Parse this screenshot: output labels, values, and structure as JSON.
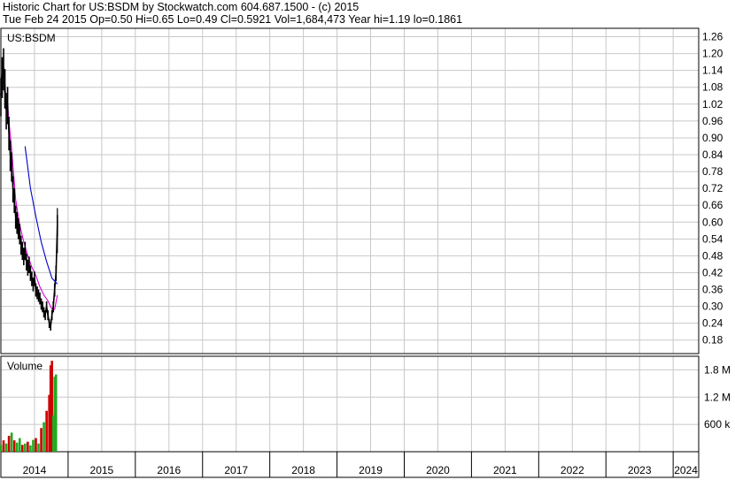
{
  "header": {
    "line1": "Historic Chart for US:BSDM by Stockwatch.com 604.687.1500 - (c) 2015",
    "line2": "Tue Feb 24 2015  Op=0.50  Hi=0.65  Lo=0.49  Cl=0.5921  Vol=1,684,473  Year hi=1.19  lo=0.1861"
  },
  "chart_data": [
    {
      "type": "line",
      "title": "US:BSDM",
      "y_ticks": [
        "1.26",
        "1.20",
        "1.14",
        "1.08",
        "1.02",
        "0.96",
        "0.90",
        "0.84",
        "0.78",
        "0.72",
        "0.66",
        "0.60",
        "0.54",
        "0.48",
        "0.42",
        "0.36",
        "0.30",
        "0.24",
        "0.18"
      ],
      "x_ticks": [
        "2014",
        "2015",
        "2016",
        "2017",
        "2018",
        "2019",
        "2020",
        "2021",
        "2022",
        "2023",
        "2024"
      ],
      "ylim": [
        0.132,
        1.29
      ],
      "xlim": [
        2014.0,
        2024.38
      ],
      "colors": {
        "price": "#000000",
        "ma_short": "#d400d4",
        "ma_long": "#0000cc",
        "grid": "#c8c8c8"
      },
      "series": [
        {
          "role": "price",
          "x": [
            2014.0,
            2014.02,
            2014.04,
            2014.06,
            2014.08,
            2014.1,
            2014.12,
            2014.14,
            2014.16,
            2014.18,
            2014.2,
            2014.22,
            2014.24,
            2014.26,
            2014.28,
            2014.3,
            2014.32,
            2014.34,
            2014.36,
            2014.38,
            2014.4,
            2014.42,
            2014.44,
            2014.46,
            2014.48,
            2014.5,
            2014.52,
            2014.54,
            2014.56,
            2014.58,
            2014.6,
            2014.62,
            2014.64,
            2014.66,
            2014.68,
            2014.7,
            2014.72,
            2014.74,
            2014.76,
            2014.78,
            2014.8,
            2014.82,
            2014.84
          ],
          "y": [
            1.05,
            1.12,
            1.15,
            1.08,
            1.0,
            1.02,
            0.92,
            0.84,
            0.8,
            0.72,
            0.68,
            0.62,
            0.6,
            0.58,
            0.56,
            0.52,
            0.5,
            0.48,
            0.5,
            0.46,
            0.44,
            0.45,
            0.42,
            0.4,
            0.38,
            0.4,
            0.36,
            0.35,
            0.34,
            0.33,
            0.31,
            0.3,
            0.28,
            0.27,
            0.3,
            0.27,
            0.24,
            0.23,
            0.27,
            0.3,
            0.36,
            0.42,
            0.59
          ]
        },
        {
          "role": "ma_short",
          "x": [
            2014.04,
            2014.1,
            2014.16,
            2014.22,
            2014.28,
            2014.34,
            2014.4,
            2014.46,
            2014.52,
            2014.58,
            2014.64,
            2014.7,
            2014.76,
            2014.8,
            2014.84
          ],
          "y": [
            1.08,
            1.01,
            0.86,
            0.68,
            0.59,
            0.53,
            0.48,
            0.44,
            0.41,
            0.37,
            0.34,
            0.32,
            0.29,
            0.29,
            0.34
          ]
        },
        {
          "role": "ma_long",
          "x": [
            2014.36,
            2014.44,
            2014.52,
            2014.6,
            2014.68,
            2014.76,
            2014.84
          ],
          "y": [
            0.87,
            0.72,
            0.62,
            0.53,
            0.46,
            0.4,
            0.38
          ]
        }
      ]
    },
    {
      "type": "bar",
      "title": "Volume",
      "y_ticks": [
        "1.8 M",
        "1.2 M",
        "600 k"
      ],
      "tick_values": [
        1800000,
        1200000,
        600000
      ],
      "ylim": [
        0,
        2100000
      ],
      "colors": {
        "up": "#22aa22",
        "down": "#cc0000"
      },
      "x": [
        2014.0,
        2014.04,
        2014.08,
        2014.12,
        2014.16,
        2014.2,
        2014.24,
        2014.28,
        2014.32,
        2014.36,
        2014.4,
        2014.44,
        2014.48,
        2014.52,
        2014.56,
        2014.6,
        2014.64,
        2014.68,
        2014.72,
        2014.74,
        2014.76,
        2014.78,
        2014.8,
        2014.82
      ],
      "values": [
        150000,
        250000,
        180000,
        350000,
        420000,
        250000,
        200000,
        300000,
        150000,
        180000,
        220000,
        140000,
        260000,
        300000,
        180000,
        520000,
        650000,
        900000,
        1250000,
        1900000,
        2000000,
        800000,
        1650000,
        1700000
      ],
      "direction": [
        "up",
        "down",
        "up",
        "down",
        "up",
        "down",
        "up",
        "up",
        "down",
        "up",
        "down",
        "up",
        "up",
        "down",
        "up",
        "down",
        "up",
        "down",
        "down",
        "down",
        "down",
        "up",
        "up",
        "up"
      ]
    }
  ]
}
